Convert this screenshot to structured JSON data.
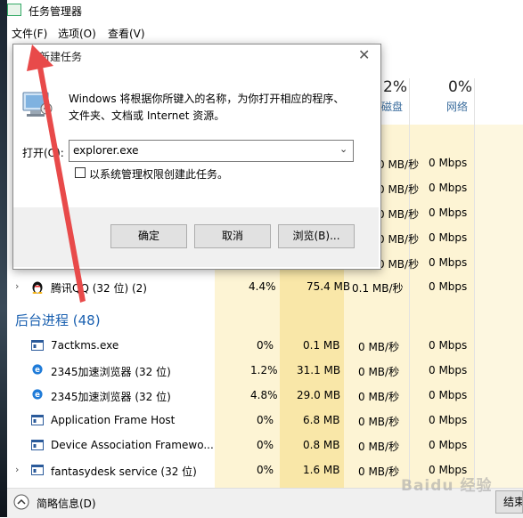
{
  "window": {
    "title": "任务管理器"
  },
  "menu": {
    "file": "文件(F)",
    "options": "选项(O)",
    "view": "查看(V)"
  },
  "columns": {
    "disk": {
      "percent": "2%",
      "label": "磁盘"
    },
    "network": {
      "percent": "0%",
      "label": "网络"
    }
  },
  "background_section": {
    "label": "后台进程 (48)"
  },
  "rows_top": [
    {
      "disk": "0 MB/秒",
      "network": "0 Mbps"
    },
    {
      "disk": "0 MB/秒",
      "network": "0 Mbps"
    },
    {
      "disk": "0 MB/秒",
      "network": "0 Mbps"
    },
    {
      "disk": "0 MB/秒",
      "network": "0 Mbps"
    },
    {
      "disk": "0 MB/秒",
      "network": "0 Mbps"
    }
  ],
  "row_qq": {
    "name": "腾讯QQ (32 位) (2)",
    "cpu": "4.4%",
    "memory": "75.4 MB",
    "disk": "0.1 MB/秒",
    "network": "0 Mbps",
    "icon": "penguin-icon"
  },
  "processes": [
    {
      "name": "7actkms.exe",
      "cpu": "0%",
      "memory": "0.1 MB",
      "disk": "0 MB/秒",
      "network": "0 Mbps",
      "icon": "app-window-icon"
    },
    {
      "name": "2345加速浏览器 (32 位)",
      "cpu": "1.2%",
      "memory": "31.1 MB",
      "disk": "0 MB/秒",
      "network": "0 Mbps",
      "icon": "browser-e-icon"
    },
    {
      "name": "2345加速浏览器 (32 位)",
      "cpu": "4.8%",
      "memory": "29.0 MB",
      "disk": "0 MB/秒",
      "network": "0 Mbps",
      "icon": "browser-e-icon"
    },
    {
      "name": "Application Frame Host",
      "cpu": "0%",
      "memory": "6.8 MB",
      "disk": "0 MB/秒",
      "network": "0 Mbps",
      "icon": "app-window-icon"
    },
    {
      "name": "Device Association Framewo...",
      "cpu": "0%",
      "memory": "0.8 MB",
      "disk": "0 MB/秒",
      "network": "0 Mbps",
      "icon": "app-window-icon"
    },
    {
      "name": "fantasydesk service (32 位)",
      "cpu": "0%",
      "memory": "1.6 MB",
      "disk": "0 MB/秒",
      "network": "0 Mbps",
      "icon": "app-window-icon"
    }
  ],
  "footer": {
    "fewer_details": "简略信息(D)",
    "end_task": "结束"
  },
  "dialog": {
    "title": "新建任务",
    "description_line1": "Windows 将根据你所键入的名称，为你打开相应的程序、",
    "description_line2": "文件夹、文档或 Internet 资源。",
    "open_label": "打开(O):",
    "open_value": "explorer.exe",
    "admin_checkbox_label": "以系统管理权限创建此任务。",
    "ok": "确定",
    "cancel": "取消",
    "browse": "浏览(B)..."
  },
  "watermark": "Baidu 经验",
  "colors": {
    "heat_light": "#fdf6dc",
    "heat_mid": "#f8e9b0",
    "heat_strong": "#f4dc94",
    "accent_blue": "#1a60b0",
    "arrow_red": "#e84a4a"
  }
}
